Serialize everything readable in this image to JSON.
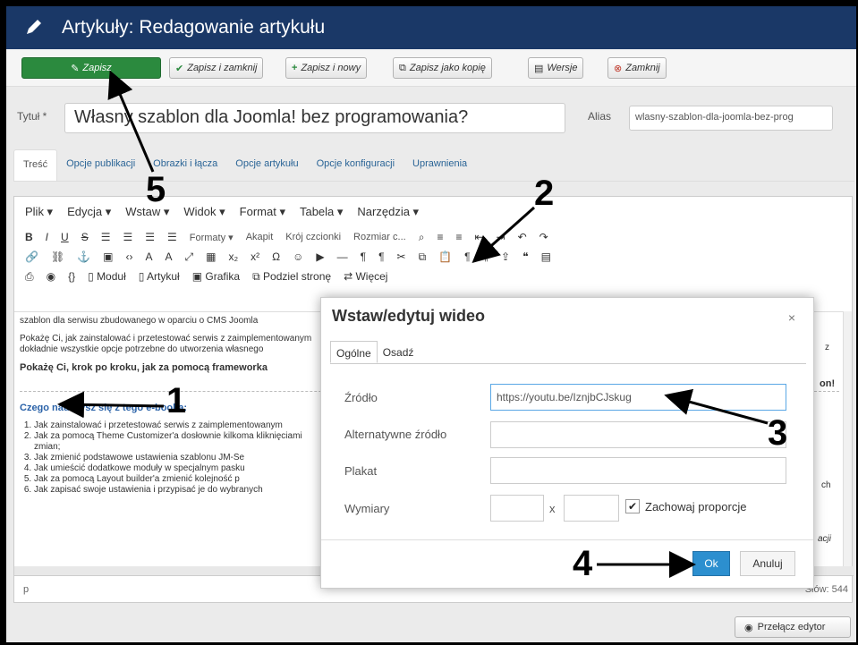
{
  "header": {
    "title": "Artykuły: Redagowanie artykułu",
    "icon": "pencil-icon"
  },
  "toolbar": {
    "save": "Zapisz",
    "save_close": "Zapisz i zamknij",
    "save_new": "Zapisz i nowy",
    "save_copy": "Zapisz jako kopię",
    "versions": "Wersje",
    "close": "Zamknij"
  },
  "form": {
    "title_label": "Tytuł *",
    "title_value": "Własny szablon dla Joomla! bez programowania?",
    "alias_label": "Alias",
    "alias_value": "wlasny-szablon-dla-joomla-bez-prog"
  },
  "tabs": [
    "Treść",
    "Opcje publikacji",
    "Obrazki i łącza",
    "Opcje artykułu",
    "Opcje konfiguracji",
    "Uprawnienia"
  ],
  "editor": {
    "menu": [
      "Plik ▾",
      "Edycja ▾",
      "Wstaw ▾",
      "Widok ▾",
      "Format ▾",
      "Tabela ▾",
      "Narzędzia ▾"
    ],
    "formats": "Formaty ▾",
    "paragraph": "Akapit",
    "font_family": "Krój czcionki",
    "font_size": "Rozmiar c...",
    "btn_module": "Moduł",
    "btn_article": "Artykuł",
    "btn_image": "Grafika",
    "btn_pagebreak": "Podziel stronę",
    "btn_more": "Więcej",
    "content": {
      "p1": "szablon dla serwisu zbudowanego w oparciu o CMS Joomla",
      "p2a": "Pokażę Ci, jak zainstalować i przetestować serwis z zaimplementowanym",
      "p2b": "dokładnie wszystkie opcje potrzebne do utworzenia własnego",
      "p3": "Pokażę Ci, krok po kroku, jak za pomocą frameworka",
      "heading": "Czego nauczysz się z tego e-booka:",
      "list": [
        "Jak zainstalować i przetestować serwis z zaimplementowanym",
        "Jak za pomocą Theme Customizer'a dosłownie kilkoma kliknięciami",
        "zmian;",
        "Jak zmienić podstawowe ustawienia szablonu JM-Se",
        "Jak umieścić dodatkowe moduły w specjalnym pasku",
        "Jak za pomocą Layout builder'a zmienić kolejność p",
        "Jak zapisać swoje ustawienia i przypisać je do wybranych"
      ],
      "right_z": "z",
      "right_on": "on!",
      "right_ch": "ch",
      "right_acr": "acji"
    },
    "status_p": "p",
    "word_count": "Słów: 544"
  },
  "toggle_editor": "Przełącz edytor",
  "dialog": {
    "title": "Wstaw/edytuj wideo",
    "close": "×",
    "tabs": [
      "Ogólne",
      "Osadź"
    ],
    "source_label": "Źródło",
    "source_value": "https://youtu.be/IznjbCJskug",
    "alt_source_label": "Alternatywne źródło",
    "poster_label": "Plakat",
    "dimensions_label": "Wymiary",
    "x": "x",
    "keep_ratio": "Zachowaj proporcje",
    "ok": "Ok",
    "cancel": "Anuluj"
  },
  "annotations": [
    "1",
    "2",
    "3",
    "4",
    "5"
  ]
}
